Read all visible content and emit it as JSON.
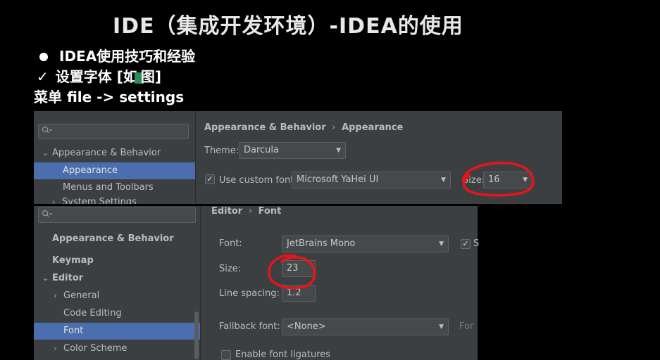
{
  "slide": {
    "title": "IDE（集成开发环境）-IDEA的使用",
    "bullet1": "IDEA使用技巧和经验",
    "check_mark": "✓",
    "bullet2_a": "设置字体 [如",
    "bullet2_b": "图]",
    "bullet3": "菜单 file -> settings"
  },
  "top_window": {
    "search_icon": "search-icon",
    "tree": [
      {
        "label": "Appearance & Behavior",
        "arrow": "⌄",
        "selected": false
      },
      {
        "label": "Appearance",
        "selected": true
      },
      {
        "label": "Menus and Toolbars",
        "selected": false
      },
      {
        "label": "System Settings",
        "arrow": "›",
        "selected": false
      }
    ],
    "breadcrumb_a": "Appearance & Behavior",
    "breadcrumb_sep": "›",
    "breadcrumb_b": "Appearance",
    "theme_label": "Theme:",
    "theme_value": "Darcula",
    "use_custom_font_label": "Use custom font:",
    "use_custom_font_checked": "✓",
    "font_value": "Microsoft YaHei UI",
    "size_label": "Size:",
    "size_value": "16"
  },
  "bottom_window": {
    "tree": [
      {
        "label": "Appearance & Behavior"
      },
      {
        "label": "Keymap"
      },
      {
        "label": "Editor",
        "arrow": "⌄"
      },
      {
        "label": "General",
        "arrow": "›"
      },
      {
        "label": "Code Editing"
      },
      {
        "label": "Font",
        "selected": true
      },
      {
        "label": "Color Scheme",
        "arrow": "›"
      }
    ],
    "breadcrumb_a": "Editor",
    "breadcrumb_sep": "›",
    "breadcrumb_b": "Font",
    "font_label": "Font:",
    "font_value": "JetBrains Mono",
    "font_check": "✓",
    "font_check_label": "S",
    "size_label": "Size:",
    "size_value": "23",
    "line_spacing_label": "Line spacing:",
    "line_spacing_value": "1.2",
    "fallback_label": "Fallback font:",
    "fallback_value": "<None>",
    "fallback_hint": "For",
    "ligatures_label": "Enable font ligatures"
  },
  "colors": {
    "annotation_red": "#e8141a",
    "selection_blue": "#4b6eaf",
    "panel_bg": "#3c3f41"
  }
}
